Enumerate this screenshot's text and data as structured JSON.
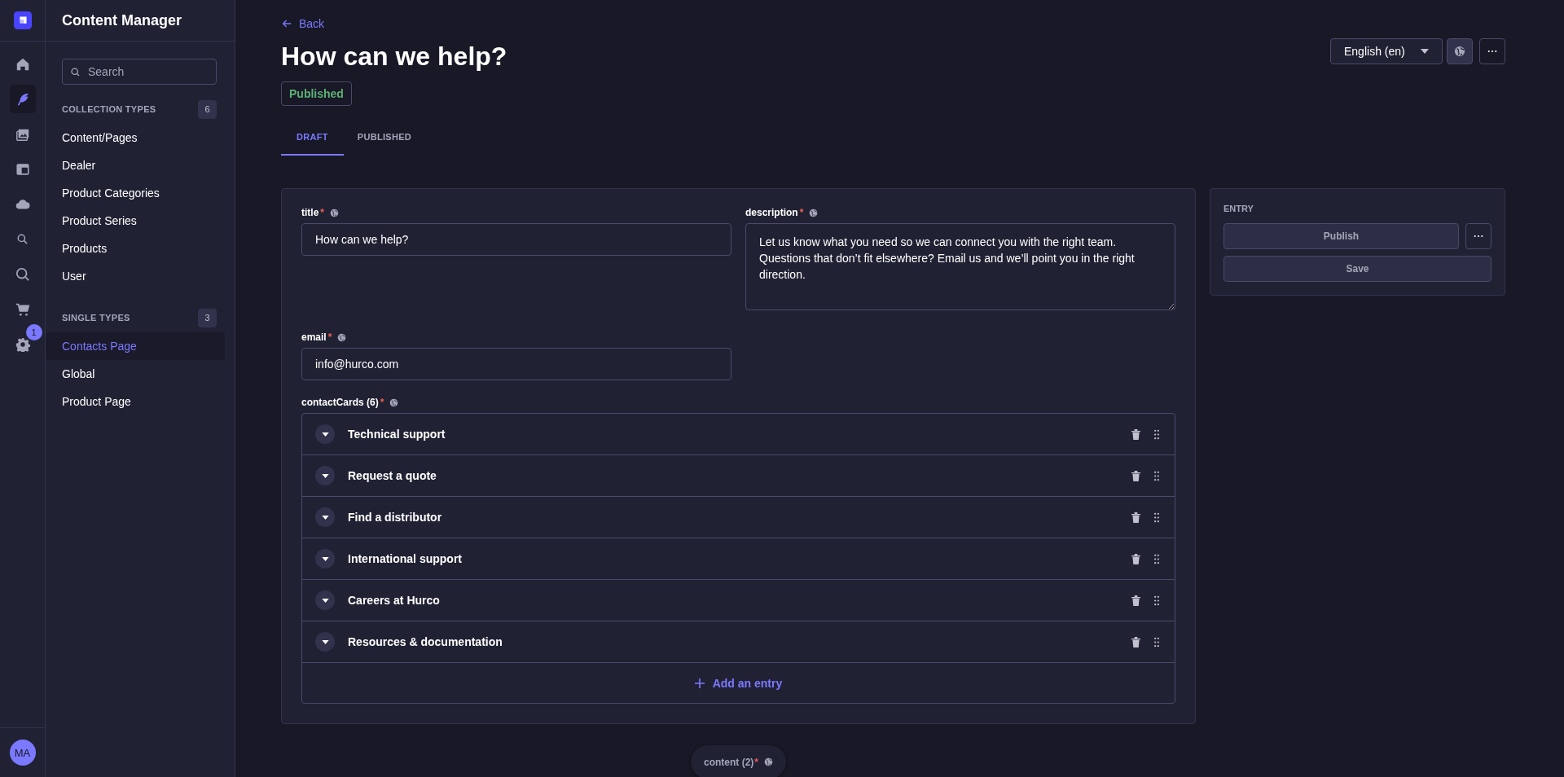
{
  "app": {
    "avatar_initials": "MA",
    "settings_badge": "1"
  },
  "nav_icons": [
    {
      "kind": "home",
      "selected": false
    },
    {
      "kind": "feather",
      "selected": true
    },
    {
      "kind": "media",
      "selected": false
    },
    {
      "kind": "layout",
      "selected": false
    },
    {
      "kind": "cloud",
      "selected": false
    },
    {
      "kind": "search",
      "selected": false
    },
    {
      "kind": "search-large",
      "selected": false
    },
    {
      "kind": "cart",
      "selected": false
    },
    {
      "kind": "gear",
      "selected": false
    }
  ],
  "sidebar": {
    "title": "Content Manager",
    "search": {
      "placeholder": "Search"
    },
    "sections": [
      {
        "heading": "COLLECTION TYPES",
        "count": "6",
        "items": [
          {
            "label": "Content/Pages",
            "selected": false
          },
          {
            "label": "Dealer",
            "selected": false
          },
          {
            "label": "Product Categories",
            "selected": false
          },
          {
            "label": "Product Series",
            "selected": false
          },
          {
            "label": "Products",
            "selected": false
          },
          {
            "label": "User",
            "selected": false
          }
        ]
      },
      {
        "heading": "SINGLE TYPES",
        "count": "3",
        "items": [
          {
            "label": "Contacts Page",
            "selected": true
          },
          {
            "label": "Global",
            "selected": false
          },
          {
            "label": "Product Page",
            "selected": false
          }
        ]
      }
    ]
  },
  "header": {
    "back": "Back",
    "title": "How can we help?",
    "status": "Published",
    "locale": "English (en)"
  },
  "tabs": [
    {
      "label": "DRAFT",
      "selected": true
    },
    {
      "label": "PUBLISHED",
      "selected": false
    }
  ],
  "fields": [
    {
      "kind": "input",
      "label": "title",
      "required_mark": "*",
      "value": "How can we help?"
    },
    {
      "kind": "textarea",
      "label": "description",
      "required_mark": "*",
      "value": "Let us know what you need so we can connect you with the right team. Questions that don’t fit elsewhere? Email us and we’ll point you in the right direction."
    },
    {
      "kind": "input",
      "label": "email",
      "required_mark": "*",
      "value": "info@hurco.com"
    }
  ],
  "contact_cards": {
    "label": "contactCards (6)",
    "required_mark": "*",
    "add_label": "Add an entry",
    "items": [
      "Technical support",
      "Request a quote",
      "Find a distributor",
      "International support",
      "Careers at Hurco",
      "Resources & documentation"
    ]
  },
  "entry_panel": {
    "heading": "ENTRY",
    "publish": "Publish",
    "save": "Save"
  },
  "content_pill": {
    "label": "content (2)",
    "required_mark": "*"
  }
}
